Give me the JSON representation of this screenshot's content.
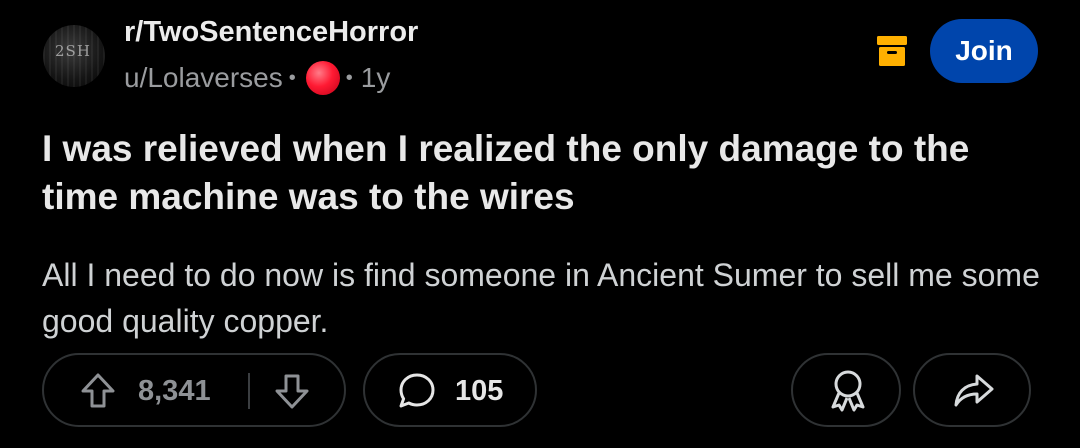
{
  "post": {
    "avatar_logo_text": "2SH",
    "subreddit": "r/TwoSentenceHorror",
    "author": "u/Lolaverses",
    "separator": "•",
    "age": "1y",
    "flair_color": "#ff1a33",
    "join_label": "Join",
    "join_color": "#0045ac",
    "archive_icon": "archive-icon",
    "archive_color": "#ffb000",
    "title": "I was relieved when I realized the only damage to the time machine was to the wires",
    "body": "All I need to do now is find someone in Ancient Sumer to sell me some good quality copper."
  },
  "actions": {
    "vote_count": "8,341",
    "comment_count": "105",
    "icons": [
      "upvote-icon",
      "downvote-icon",
      "comment-icon",
      "award-icon",
      "share-icon"
    ]
  }
}
